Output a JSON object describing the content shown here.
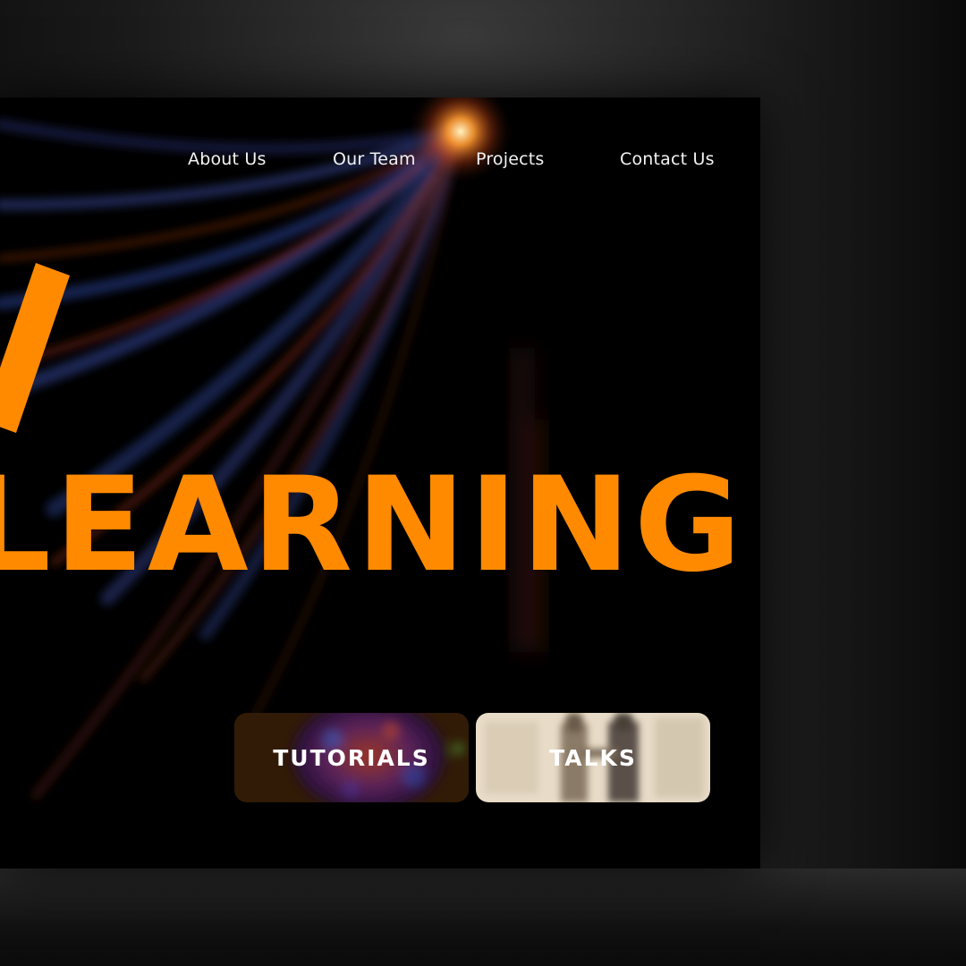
{
  "nav": {
    "items": [
      {
        "label": "About Us"
      },
      {
        "label": "Our Team"
      },
      {
        "label": "Projects"
      },
      {
        "label": "Contact Us"
      }
    ]
  },
  "hero": {
    "headline": "LEARNING"
  },
  "cards": [
    {
      "label": "TUTORIALS"
    },
    {
      "label": "TALKS"
    }
  ],
  "colors": {
    "accent": "#ff8a00",
    "background": "#000000",
    "nav_text": "#f2f2f2"
  }
}
